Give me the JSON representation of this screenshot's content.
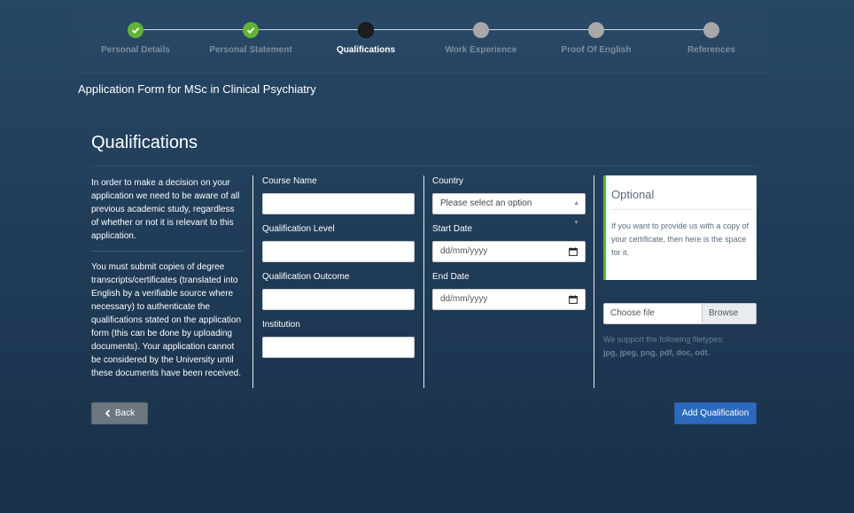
{
  "stepper": {
    "steps": [
      {
        "label": "Personal Details",
        "state": "done"
      },
      {
        "label": "Personal Statement",
        "state": "done"
      },
      {
        "label": "Qualifications",
        "state": "current"
      },
      {
        "label": "Work Experience",
        "state": "todo"
      },
      {
        "label": "Proof Of English",
        "state": "todo"
      },
      {
        "label": "References",
        "state": "todo"
      }
    ]
  },
  "app_title": "Application Form for MSc in Clinical Psychiatry",
  "section_title": "Qualifications",
  "intro": {
    "p1": "In order to make a decision on your application we need to be aware of all previous academic study, regardless of whether or not it is relevant to this application.",
    "p2": "You must submit copies of degree transcripts/certificates (translated into English by a verifiable source where necessary) to authenticate the qualifications stated on the application form (this can be done by uploading documents). Your application cannot be considered by the University until these documents have been received."
  },
  "form": {
    "course_name_label": "Course Name",
    "course_name_value": "",
    "qualification_level_label": "Qualification Level",
    "qualification_level_value": "",
    "qualification_outcome_label": "Qualification Outcome",
    "qualification_outcome_value": "",
    "institution_label": "Institution",
    "institution_value": "",
    "country_label": "Country",
    "country_selected": "Please select an option",
    "start_date_label": "Start Date",
    "start_date_placeholder": "dd/mm/yyyy",
    "end_date_label": "End Date",
    "end_date_placeholder": "dd/mm/yyyy"
  },
  "optional": {
    "title": "Optional",
    "text": "If you want to provide us with a copy of your certificate, then here is the space for it."
  },
  "file_upload": {
    "label": "Choose file",
    "browse": "Browse",
    "support_text": "We support the following filetypes:",
    "filetypes": "jpg, jpeg, png, pdf, doc, odt."
  },
  "buttons": {
    "back": "Back",
    "add": "Add Qualification"
  },
  "colors": {
    "background": "#234160",
    "done": "#62b336",
    "current": "#1e1e1e",
    "todo": "#a8a8a8",
    "primary_button": "#2b6bbd",
    "back_button": "#6c7780",
    "optional_accent": "#5fb336"
  }
}
